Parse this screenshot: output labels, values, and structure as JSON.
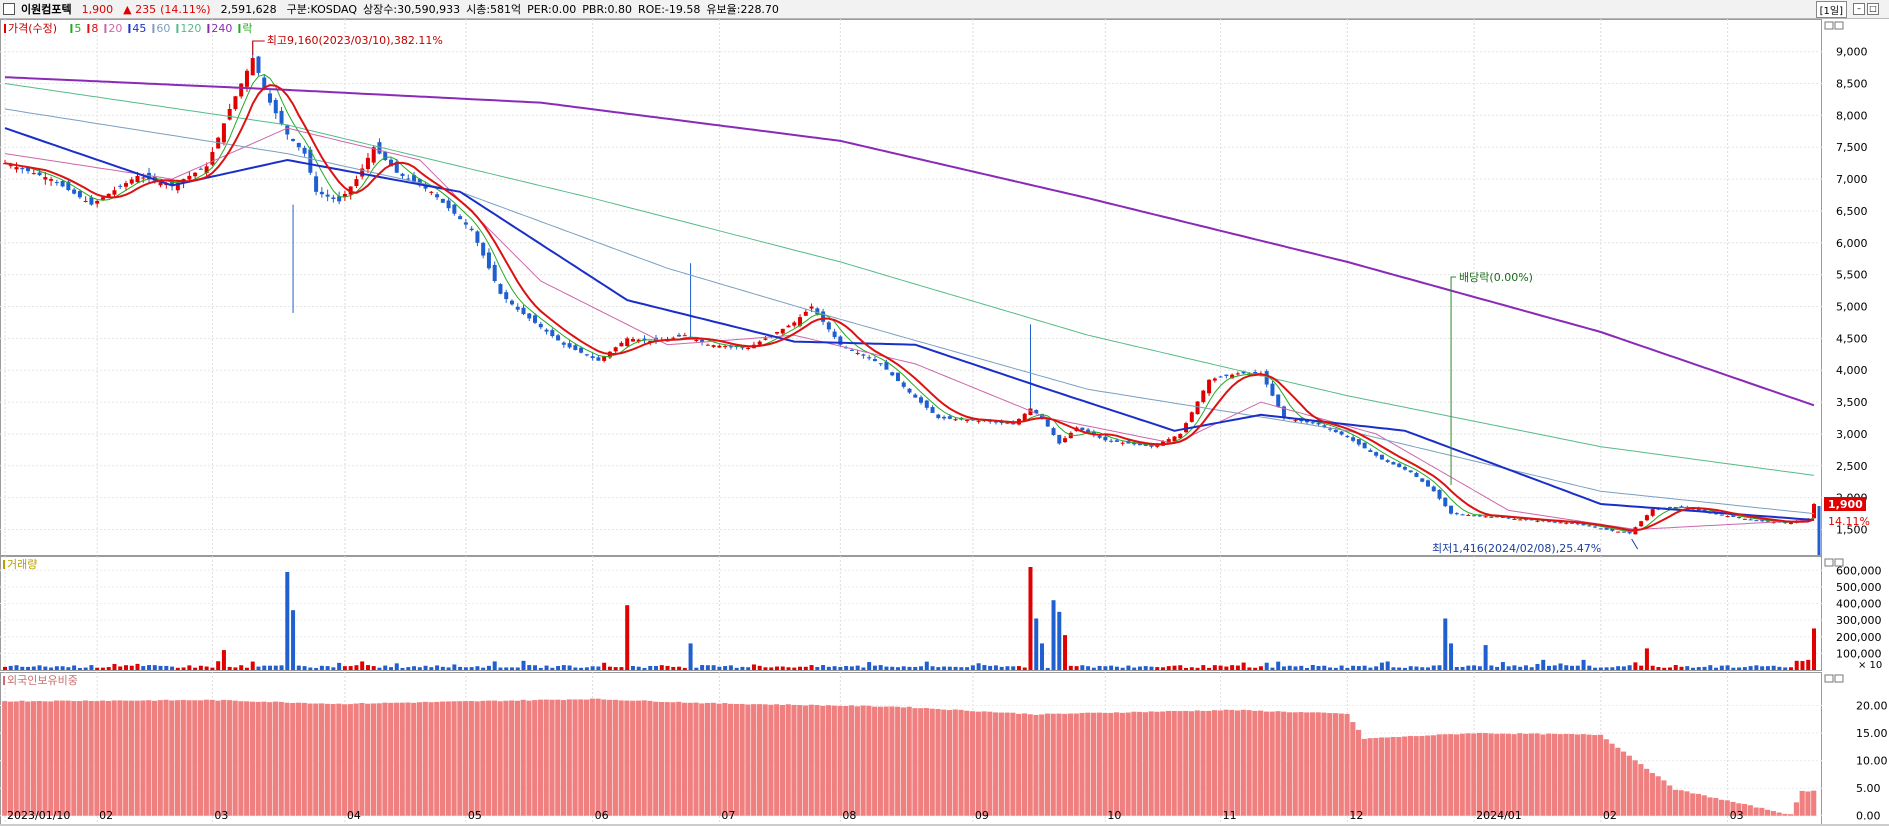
{
  "header": {
    "stock_name": "이원컴포텍",
    "price": "1,900",
    "change": "▲ 235",
    "change_pct": "(14.11%)",
    "volume": "2,591,628",
    "market": "구분:KOSDAQ",
    "listed_shares": "상장수:30,590,933",
    "market_cap": "시총:581억",
    "per": "PER:0.00",
    "pbr": "PBR:0.80",
    "roe": "ROE:-19.58",
    "reserve": "유보율:228.70",
    "period": "[1일]"
  },
  "colors": {
    "up": "#e00000",
    "down": "#1f5fd0",
    "ma5": "#22aa22",
    "ma8": "#dd1111",
    "ma20": "#cc66aa",
    "ma45": "#1a2fc8",
    "ma60": "#7a9fc0",
    "ma120": "#55bb88",
    "ma240": "#8a2ab8",
    "foreign": "#f08080"
  },
  "chart_data": [
    {
      "type": "candlestick",
      "legend": [
        {
          "label": "가격(수정)",
          "color": "#e00000"
        },
        {
          "label": "5",
          "color": "#22aa22"
        },
        {
          "label": "8",
          "color": "#dd1111"
        },
        {
          "label": "20",
          "color": "#cc66aa"
        },
        {
          "label": "45",
          "color": "#1a2fc8"
        },
        {
          "label": "60",
          "color": "#7a9fc0"
        },
        {
          "label": "120",
          "color": "#55bb88"
        },
        {
          "label": "240",
          "color": "#8a2ab8"
        },
        {
          "label": "락",
          "color": "#22aa22"
        }
      ],
      "yticks": [
        "9,000",
        "8,500",
        "8,000",
        "7,500",
        "7,000",
        "6,500",
        "6,000",
        "5,500",
        "5,000",
        "4,500",
        "4,000",
        "3,500",
        "3,000",
        "2,500",
        "2,000",
        "1,500"
      ],
      "ylim": [
        1100,
        9450
      ],
      "annotations": {
        "high": "최고9,160(2023/03/10),382.11%",
        "low": "최저1,416(2024/02/08),25.47%",
        "dividend": "배당락(0.00%)"
      },
      "price_tag": "1,900",
      "pct_tag": "14.11%",
      "ohlc_keyframes": [
        [
          "2023-01-10",
          7250
        ],
        [
          "2023-01-20",
          7000
        ],
        [
          "2023-01-31",
          6600
        ],
        [
          "2023-02-10",
          7050
        ],
        [
          "2023-02-20",
          6900
        ],
        [
          "2023-02-28",
          7200
        ],
        [
          "2023-03-06",
          8100
        ],
        [
          "2023-03-10",
          8900
        ],
        [
          "2023-03-15",
          8200
        ],
        [
          "2023-03-20",
          7700
        ],
        [
          "2023-03-23",
          7400
        ],
        [
          "2023-03-27",
          6800
        ],
        [
          "2023-03-31",
          6650
        ],
        [
          "2023-04-05",
          7000
        ],
        [
          "2023-04-10",
          7500
        ],
        [
          "2023-04-14",
          7100
        ],
        [
          "2023-04-24",
          6800
        ],
        [
          "2023-05-03",
          6200
        ],
        [
          "2023-05-10",
          5200
        ],
        [
          "2023-05-15",
          4950
        ],
        [
          "2023-05-25",
          4400
        ],
        [
          "2023-06-02",
          4150
        ],
        [
          "2023-06-09",
          4500
        ],
        [
          "2023-06-16",
          4450
        ],
        [
          "2023-06-23",
          4550
        ],
        [
          "2023-06-29",
          4400
        ],
        [
          "2023-07-10",
          4350
        ],
        [
          "2023-07-20",
          4750
        ],
        [
          "2023-07-25",
          5000
        ],
        [
          "2023-08-01",
          4400
        ],
        [
          "2023-08-10",
          4100
        ],
        [
          "2023-08-17",
          3650
        ],
        [
          "2023-08-24",
          3250
        ],
        [
          "2023-09-05",
          3200
        ],
        [
          "2023-09-12",
          3150
        ],
        [
          "2023-09-15",
          3400
        ],
        [
          "2023-09-19",
          3250
        ],
        [
          "2023-09-22",
          2850
        ],
        [
          "2023-09-27",
          3100
        ],
        [
          "2023-10-04",
          2900
        ],
        [
          "2023-10-16",
          2800
        ],
        [
          "2023-10-23",
          3000
        ],
        [
          "2023-10-30",
          3850
        ],
        [
          "2023-11-06",
          3950
        ],
        [
          "2023-11-10",
          3950
        ],
        [
          "2023-11-16",
          3250
        ],
        [
          "2023-11-24",
          3150
        ],
        [
          "2023-12-01",
          2950
        ],
        [
          "2023-12-11",
          2600
        ],
        [
          "2023-12-18",
          2400
        ],
        [
          "2023-12-22",
          2100
        ],
        [
          "2023-12-27",
          1750
        ],
        [
          "2024-01-05",
          1700
        ],
        [
          "2024-01-15",
          1650
        ],
        [
          "2024-01-25",
          1600
        ],
        [
          "2024-02-05",
          1480
        ],
        [
          "2024-02-08",
          1440
        ],
        [
          "2024-02-14",
          1820
        ],
        [
          "2024-02-21",
          1860
        ],
        [
          "2024-02-29",
          1740
        ],
        [
          "2024-03-11",
          1640
        ],
        [
          "2024-03-18",
          1600
        ],
        [
          "2024-03-22",
          1665
        ],
        [
          "2024-03-25",
          1900
        ]
      ],
      "ma_keyframes": {
        "240": [
          [
            "2023-01-10",
            8600
          ],
          [
            "2023-03-20",
            8400
          ],
          [
            "2023-05-20",
            8200
          ],
          [
            "2023-08-01",
            7600
          ],
          [
            "2023-10-01",
            6700
          ],
          [
            "2023-12-01",
            5700
          ],
          [
            "2024-02-01",
            4600
          ],
          [
            "2024-03-25",
            3450
          ]
        ],
        "120": [
          [
            "2023-01-10",
            8500
          ],
          [
            "2023-03-20",
            7850
          ],
          [
            "2023-06-01",
            6700
          ],
          [
            "2023-08-01",
            5700
          ],
          [
            "2023-10-01",
            4550
          ],
          [
            "2023-12-01",
            3600
          ],
          [
            "2024-02-01",
            2800
          ],
          [
            "2024-03-25",
            2350
          ]
        ],
        "60": [
          [
            "2023-01-10",
            8100
          ],
          [
            "2023-03-20",
            7400
          ],
          [
            "2023-05-01",
            6800
          ],
          [
            "2023-06-20",
            5600
          ],
          [
            "2023-08-01",
            4800
          ],
          [
            "2023-10-01",
            3700
          ],
          [
            "2023-12-01",
            3050
          ],
          [
            "2024-02-01",
            2100
          ],
          [
            "2024-03-25",
            1750
          ]
        ],
        "45": [
          [
            "2023-01-10",
            7800
          ],
          [
            "2023-02-20",
            6900
          ],
          [
            "2023-03-20",
            7300
          ],
          [
            "2023-05-01",
            6800
          ],
          [
            "2023-06-10",
            5100
          ],
          [
            "2023-07-20",
            4450
          ],
          [
            "2023-08-20",
            4400
          ],
          [
            "2023-09-20",
            3700
          ],
          [
            "2023-10-20",
            3050
          ],
          [
            "2023-11-10",
            3300
          ],
          [
            "2023-12-15",
            3050
          ],
          [
            "2024-02-01",
            1900
          ],
          [
            "2024-03-25",
            1650
          ]
        ],
        "20": [
          [
            "2023-01-10",
            7400
          ],
          [
            "2023-02-20",
            7000
          ],
          [
            "2023-03-20",
            7800
          ],
          [
            "2023-04-20",
            7300
          ],
          [
            "2023-05-20",
            5400
          ],
          [
            "2023-06-20",
            4400
          ],
          [
            "2023-07-20",
            4550
          ],
          [
            "2023-08-20",
            4100
          ],
          [
            "2023-09-20",
            3250
          ],
          [
            "2023-10-20",
            2850
          ],
          [
            "2023-11-10",
            3500
          ],
          [
            "2023-12-10",
            3000
          ],
          [
            "2024-01-10",
            1800
          ],
          [
            "2024-02-10",
            1500
          ],
          [
            "2024-03-25",
            1650
          ]
        ]
      }
    },
    {
      "type": "bar",
      "title": "거래량",
      "yticks": [
        "600,000",
        "500,000",
        "400,000",
        "300,000",
        "200,000",
        "100,000"
      ],
      "yunit": "× 10",
      "ylim": [
        0,
        650000
      ],
      "spikes": [
        [
          "2023-03-20",
          590000
        ],
        [
          "2023-03-21",
          360000
        ],
        [
          "2023-03-03",
          120000
        ],
        [
          "2023-06-09",
          390000
        ],
        [
          "2023-06-26",
          160000
        ],
        [
          "2023-09-15",
          620000
        ],
        [
          "2023-09-18",
          310000
        ],
        [
          "2023-09-19",
          160000
        ],
        [
          "2023-09-21",
          420000
        ],
        [
          "2023-09-22",
          350000
        ],
        [
          "2023-09-25",
          210000
        ],
        [
          "2023-12-26",
          310000
        ],
        [
          "2023-12-27",
          160000
        ],
        [
          "2024-01-04",
          150000
        ],
        [
          "2024-02-13",
          130000
        ],
        [
          "2024-03-25",
          250000
        ]
      ]
    },
    {
      "type": "bar",
      "title": "외국인보유비중",
      "yticks": [
        "20.00",
        "15.00",
        "10.00",
        "5.00",
        "0.00"
      ],
      "ylim": [
        -1.5,
        25
      ],
      "levels": [
        [
          "2023-01-10",
          20.8
        ],
        [
          "2023-03-01",
          21.0
        ],
        [
          "2023-04-01",
          20.3
        ],
        [
          "2023-06-01",
          21.2
        ],
        [
          "2023-07-01",
          20.4
        ],
        [
          "2023-08-15",
          19.8
        ],
        [
          "2023-09-18",
          18.4
        ],
        [
          "2023-10-10",
          18.8
        ],
        [
          "2023-11-05",
          19.2
        ],
        [
          "2023-12-01",
          18.5
        ],
        [
          "2023-12-06",
          14.0
        ],
        [
          "2024-01-02",
          15.0
        ],
        [
          "2024-02-01",
          14.7
        ],
        [
          "2024-02-20",
          4.8
        ],
        [
          "2024-03-19",
          0.2
        ],
        [
          "2024-03-21",
          4.5
        ]
      ]
    }
  ],
  "x_axis": {
    "labels": [
      [
        "2023-01-10",
        "2023/01/10"
      ],
      [
        "2023-02-01",
        "02"
      ],
      [
        "2023-03-01",
        "03"
      ],
      [
        "2023-04-03",
        "04"
      ],
      [
        "2023-05-02",
        "05"
      ],
      [
        "2023-06-01",
        "06"
      ],
      [
        "2023-07-03",
        "07"
      ],
      [
        "2023-08-01",
        "08"
      ],
      [
        "2023-09-01",
        "09"
      ],
      [
        "2023-10-04",
        "10"
      ],
      [
        "2023-11-01",
        "11"
      ],
      [
        "2023-12-01",
        "12"
      ],
      [
        "2024-01-02",
        "2024/01"
      ],
      [
        "2024-02-01",
        "02"
      ],
      [
        "2024-03-04",
        "03"
      ]
    ]
  }
}
